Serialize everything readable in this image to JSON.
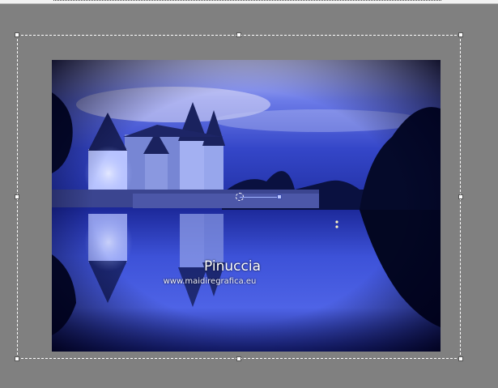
{
  "canvas": {
    "background_color": "#808080",
    "image_description_colors": {
      "sky": "#3a4fd0",
      "night": "#0b1240"
    }
  },
  "watermark": {
    "title": "Pinuccia",
    "url": "www.maidiregrafica.eu"
  },
  "selection": {
    "tool": "pick-tool",
    "handle-icon": "square-handle"
  }
}
